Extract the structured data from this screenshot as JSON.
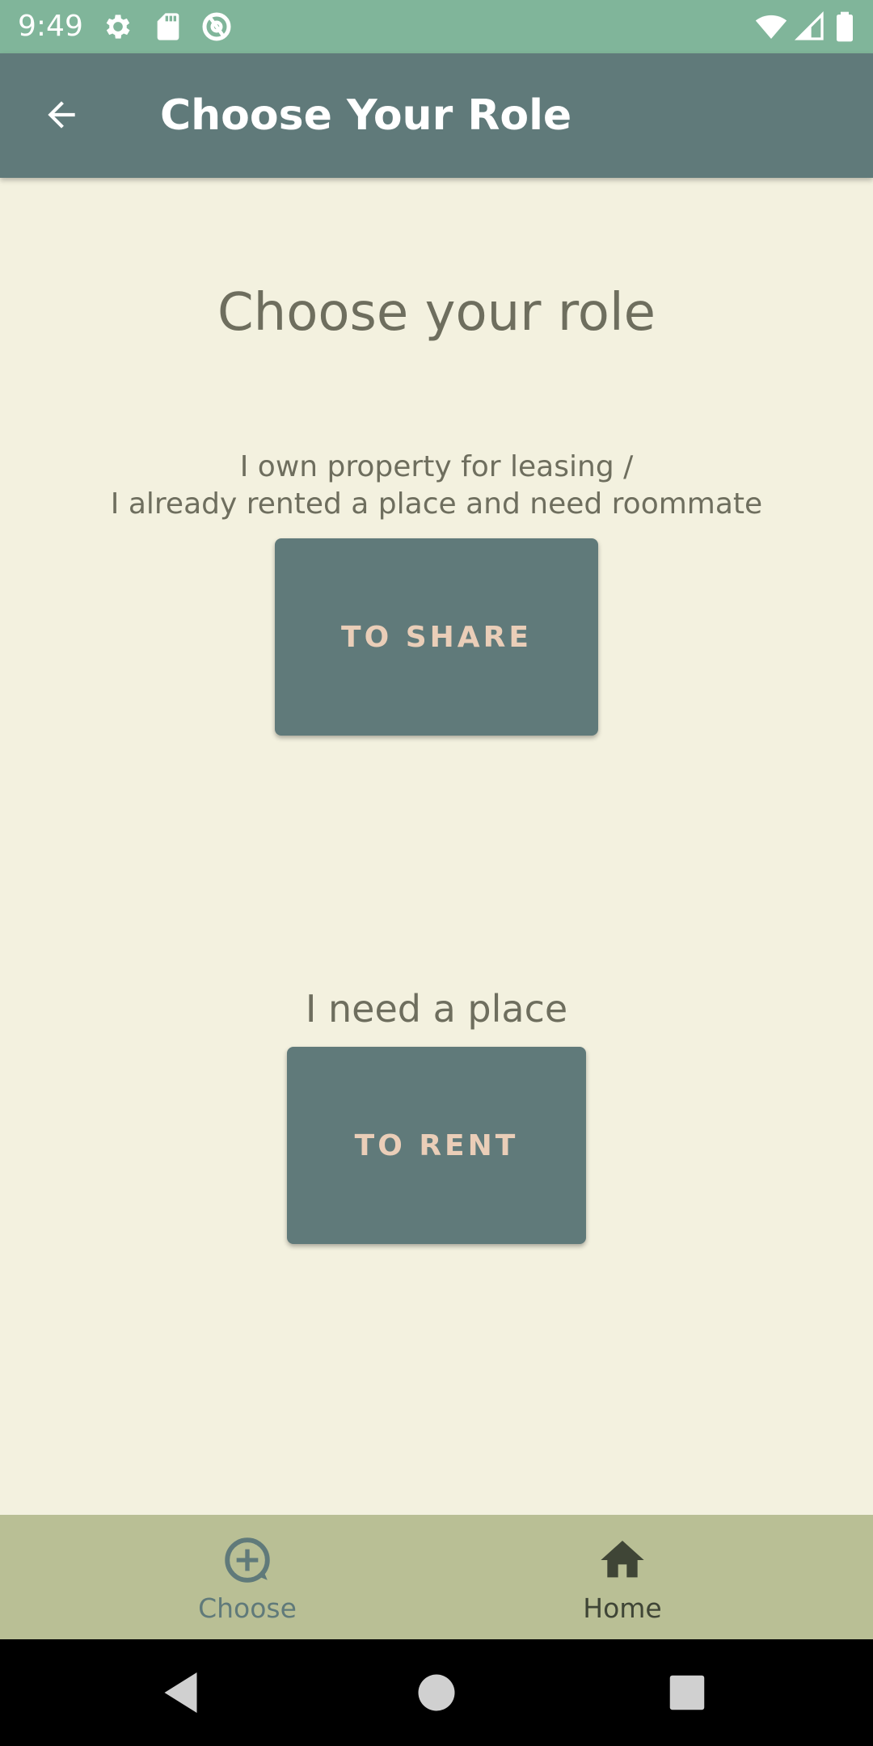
{
  "status_bar": {
    "time": "9:49",
    "left_icons": [
      "gear-icon",
      "sd-card-icon",
      "at-sign-icon"
    ],
    "right_icons": [
      "wifi-icon",
      "cell-signal-icon",
      "battery-icon"
    ],
    "background": "#80B59A"
  },
  "app_bar": {
    "title": "Choose Your Role",
    "back_icon": "arrow-back-icon",
    "background": "#607A7A"
  },
  "main": {
    "heading": "Choose your role",
    "share": {
      "line1": "I own property for leasing /",
      "line2": "I already rented a place and need roommate",
      "button_label": "TO SHARE"
    },
    "rent": {
      "description": "I need a place",
      "button_label": "TO RENT"
    }
  },
  "bottom_nav": {
    "items": [
      {
        "label": "Choose",
        "icon": "add-circle-icon",
        "selected": true
      },
      {
        "label": "Home",
        "icon": "home-icon",
        "selected": false
      }
    ],
    "background": "#B9BF95"
  },
  "system_nav": {
    "buttons": [
      "back-triangle-icon",
      "home-circle-icon",
      "recents-square-icon"
    ]
  },
  "colors": {
    "page_background": "#F3F1DF",
    "button_background": "#607A7A",
    "button_text": "#EACEB8",
    "body_text": "#6E6E5E"
  }
}
